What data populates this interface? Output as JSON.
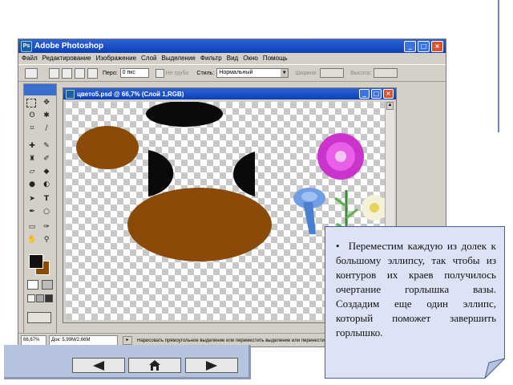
{
  "app": {
    "title": "Adobe Photoshop",
    "logo_text": "Ps"
  },
  "menu": [
    "Файл",
    "Редактирование",
    "Изображение",
    "Слой",
    "Выделение",
    "Фильтр",
    "Вид",
    "Окно",
    "Помощь"
  ],
  "options_bar": {
    "feather_label": "Перо:",
    "feather_value": "0 пкс",
    "antialias_label": "Не грубо",
    "style_label": "Стиль:",
    "style_value": "Нормальный",
    "width_label": "Ширина:",
    "height_label": "Высота:"
  },
  "document": {
    "title": "цвето5.psd @ 66,7% (Слой 1,RGB)"
  },
  "status": {
    "zoom": "66,67%",
    "doc_info": "Док: 5,99М/2,66М",
    "hint": "Нарисовать прямоугольное выделение или переместить выделение или перенести выделение"
  },
  "note": {
    "text": "Переместим каждую из долек к большому эллипсу, так чтобы из контуров их краев получилось очертание горлышка вазы. Создадим еще один эллипс, который поможет завершить горлышко."
  },
  "nav": {
    "prev_icon": "left-arrow-icon",
    "home_icon": "home-icon",
    "next_icon": "right-arrow-icon"
  },
  "colors": {
    "brown": "#8B4A08",
    "black": "#0a0a0a",
    "title_blue": "#0a3fb8"
  }
}
